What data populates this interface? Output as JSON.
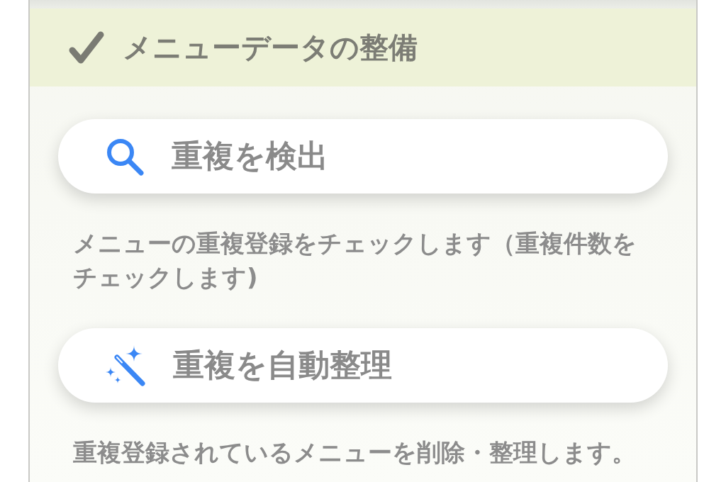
{
  "section": {
    "title": "メニューデータの整備"
  },
  "actions": [
    {
      "kind": "search",
      "label": "重複を検出",
      "description": "メニューの重複登録をチェックします（重複件数をチェックします)"
    },
    {
      "kind": "wand",
      "label": "重複を自動整理",
      "description": "重複登録されているメニューを削除・整理します。"
    }
  ]
}
